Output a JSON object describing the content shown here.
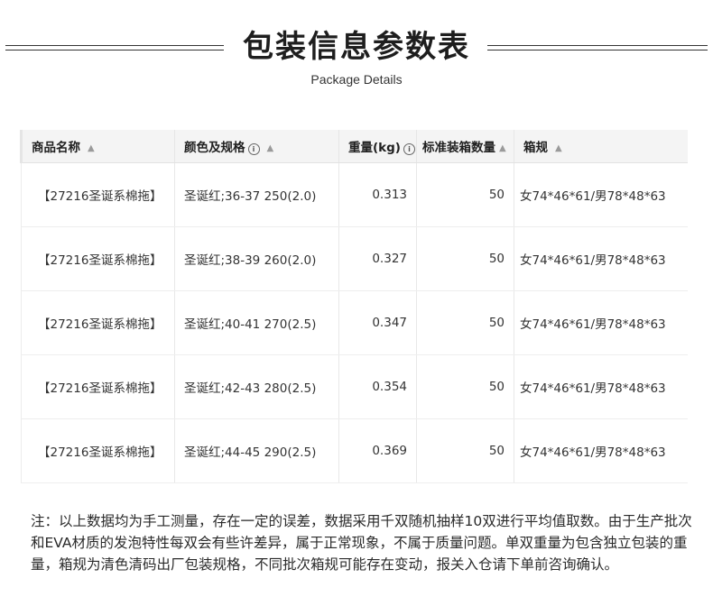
{
  "header": {
    "title": "包装信息参数表",
    "subtitle": "Package Details"
  },
  "table": {
    "columns": [
      {
        "label": "商品名称",
        "icon": "sort-arrow-icon"
      },
      {
        "label": "颜色及规格",
        "icon": "info-icon"
      },
      {
        "label": "重量(kg)",
        "icon": "info-icon"
      },
      {
        "label": "标准装箱数量",
        "icon": "sort-arrow-icon"
      },
      {
        "label": "箱规",
        "icon": "sort-arrow-icon"
      }
    ],
    "rows": [
      {
        "name": "【27216圣诞系棉拖】",
        "spec": "圣诞红;36-37 250(2.0)",
        "weight": "0.313",
        "qty": "50",
        "box": "女74*46*61/男78*48*63"
      },
      {
        "name": "【27216圣诞系棉拖】",
        "spec": "圣诞红;38-39 260(2.0)",
        "weight": "0.327",
        "qty": "50",
        "box": "女74*46*61/男78*48*63"
      },
      {
        "name": "【27216圣诞系棉拖】",
        "spec": "圣诞红;40-41 270(2.5)",
        "weight": "0.347",
        "qty": "50",
        "box": "女74*46*61/男78*48*63"
      },
      {
        "name": "【27216圣诞系棉拖】",
        "spec": "圣诞红;42-43 280(2.5)",
        "weight": "0.354",
        "qty": "50",
        "box": "女74*46*61/男78*48*63"
      },
      {
        "name": "【27216圣诞系棉拖】",
        "spec": "圣诞红;44-45 290(2.5)",
        "weight": "0.369",
        "qty": "50",
        "box": "女74*46*61/男78*48*63"
      }
    ]
  },
  "note": "注：以上数据均为手工测量，存在一定的误差，数据采用千双随机抽样10双进行平均值取数。由于生产批次和EVA材质的发泡特性每双会有些许差异，属于正常现象，不属于质量问题。单双重量为包含独立包装的重量，箱规为清色清码出厂包装规格，不同批次箱规可能存在变动，报关入仓请下单前咨询确认。"
}
